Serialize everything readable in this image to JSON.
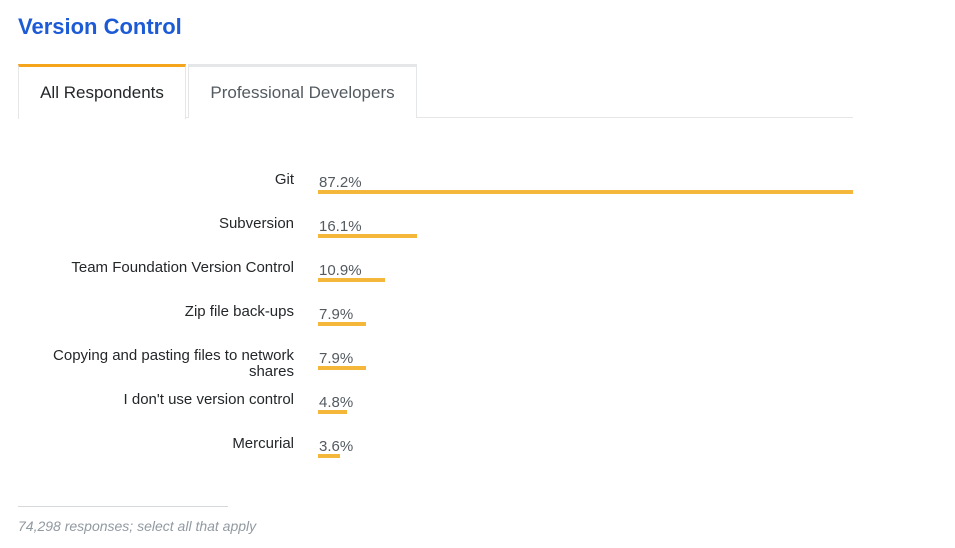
{
  "title": "Version Control",
  "tabs": [
    {
      "label": "All Respondents",
      "active": true
    },
    {
      "label": "Professional Developers",
      "active": false
    }
  ],
  "footer_note": "74,298 responses; select all that apply",
  "colors": {
    "accent": "#f4a51c",
    "bar": "#f4b73a",
    "title": "#1d5bd6"
  },
  "chart_data": {
    "type": "bar",
    "orientation": "horizontal",
    "categories": [
      "Git",
      "Subversion",
      "Team Foundation Version Control",
      "Zip file back-ups",
      "Copying and pasting files to network shares",
      "I don't use version control",
      "Mercurial"
    ],
    "values": [
      87.2,
      16.1,
      10.9,
      7.9,
      7.9,
      4.8,
      3.6
    ],
    "value_labels": [
      "87.2%",
      "16.1%",
      "10.9%",
      "7.9%",
      "7.9%",
      "4.8%",
      "3.6%"
    ],
    "unit": "%",
    "title": "Version Control",
    "grid": false
  }
}
